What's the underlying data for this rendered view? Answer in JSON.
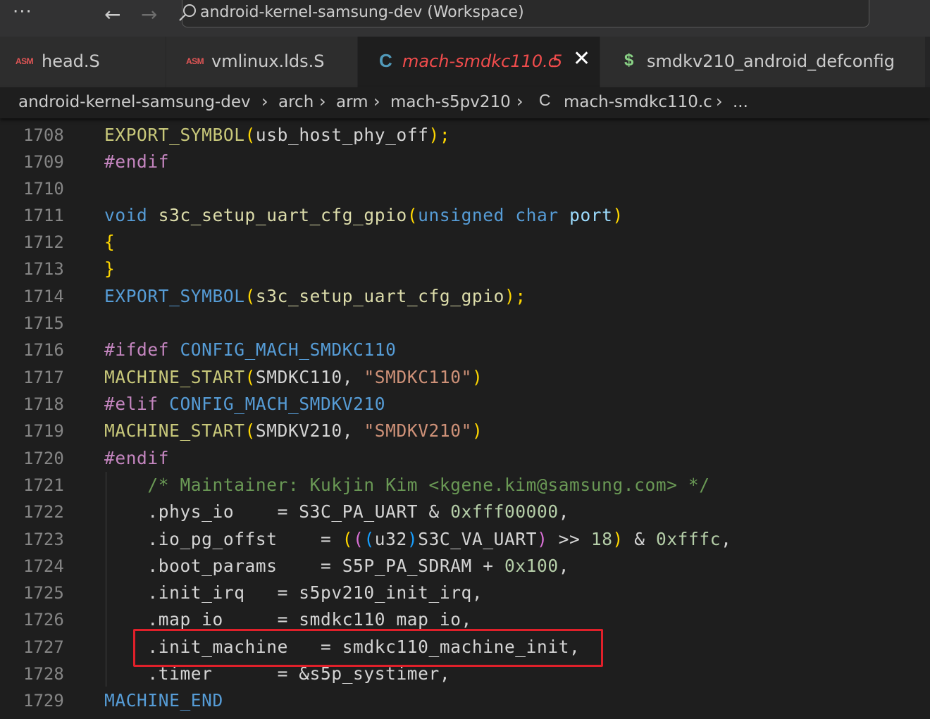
{
  "titlebar": {
    "menu_glyph": "···",
    "back_glyph": "←",
    "forward_glyph": "→",
    "search_text": "android-kernel-samsung-dev (Workspace)"
  },
  "tabs": [
    {
      "icon_text": "ASM",
      "label": "head.S"
    },
    {
      "icon_text": "ASM",
      "label": "vmlinux.lds.S"
    },
    {
      "icon_text": "C",
      "label": "mach-smdkc110.c",
      "problems": "5",
      "close": "✕"
    },
    {
      "icon_text": "$",
      "label": "smdkv210_android_defconfig"
    }
  ],
  "breadcrumb": {
    "items": [
      "android-kernel-samsung-dev",
      "arch",
      "arm",
      "mach-s5pv210",
      "mach-smdkc110.c",
      "..."
    ],
    "file_icon": "C",
    "separator": "›"
  },
  "editor": {
    "lines": [
      {
        "n": "1708",
        "t": [
          "EXPORT_SYMBOL",
          "(",
          "usb_host_phy_off",
          ");"
        ]
      },
      {
        "n": "1709",
        "t": [
          "#endif"
        ]
      },
      {
        "n": "1710",
        "t": []
      },
      {
        "n": "1711",
        "t": [
          "void",
          " s3c_setup_uart_cfg_gpio",
          "(",
          "unsigned",
          " char",
          " port",
          ")"
        ]
      },
      {
        "n": "1712",
        "t": [
          "{"
        ]
      },
      {
        "n": "1713",
        "t": [
          "}"
        ]
      },
      {
        "n": "1714",
        "t": [
          "EXPORT_SYMBOL",
          "(",
          "s3c_setup_uart_cfg_gpio",
          ");"
        ]
      },
      {
        "n": "1715",
        "t": []
      },
      {
        "n": "1716",
        "t": [
          "#ifdef",
          " CONFIG_MACH_SMDKC110"
        ]
      },
      {
        "n": "1717",
        "t": [
          "MACHINE_START",
          "(",
          "SMDKC110, ",
          "\"SMDKC110\"",
          ")"
        ]
      },
      {
        "n": "1718",
        "t": [
          "#elif",
          " CONFIG_MACH_SMDKV210"
        ]
      },
      {
        "n": "1719",
        "t": [
          "MACHINE_START",
          "(",
          "SMDKV210, ",
          "\"SMDKV210\"",
          ")"
        ]
      },
      {
        "n": "1720",
        "t": [
          "#endif"
        ]
      },
      {
        "n": "1721",
        "t": [
          "    /* Maintainer: Kukjin Kim <kgene.kim@samsung.com> */"
        ]
      },
      {
        "n": "1722",
        "t": [
          "    .phys_io    = S3C_PA_UART & ",
          "0xfff00000",
          ","
        ]
      },
      {
        "n": "1723",
        "t": [
          "    .io_pg_offst    = ",
          "(",
          "(",
          "(",
          "u32",
          ")",
          "S3C_VA_UART",
          ")",
          " >> ",
          "18",
          ")",
          " & ",
          "0xfffc",
          ","
        ]
      },
      {
        "n": "1724",
        "t": [
          "    .boot_params    = S5P_PA_SDRAM + ",
          "0x100",
          ","
        ]
      },
      {
        "n": "1725",
        "t": [
          "    .init_irq   = s5pv210_init_irq,"
        ]
      },
      {
        "n": "1726",
        "t": [
          "    .map_io     = smdkc110_map_io,"
        ]
      },
      {
        "n": "1727",
        "t": [
          "    .init_machine   = smdkc110_machine_init,"
        ]
      },
      {
        "n": "1728",
        "t": [
          "    .timer      = &s5p_systimer,"
        ]
      },
      {
        "n": "1729",
        "t": [
          "MACHINE_END"
        ]
      }
    ]
  },
  "colors": {
    "highlight_box": "#e0202a",
    "modified_tab": "#f14c4c"
  }
}
